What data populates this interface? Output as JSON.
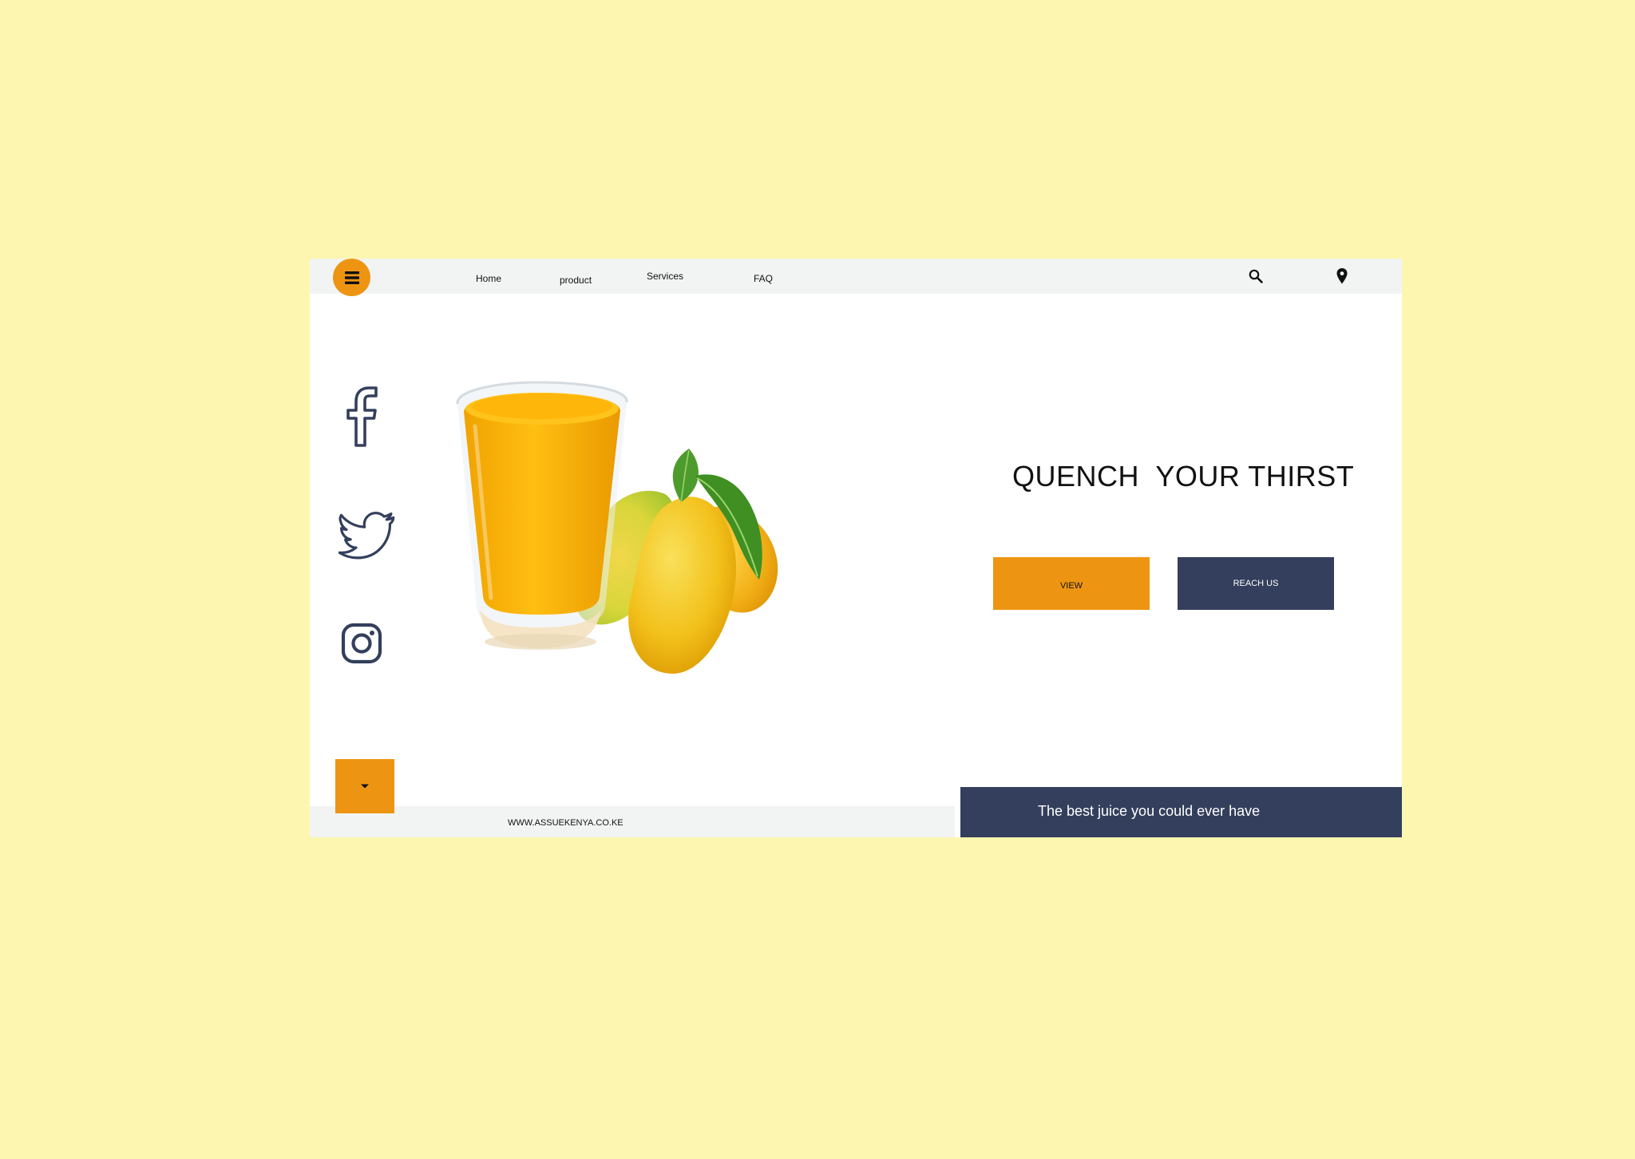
{
  "nav": {
    "items": [
      {
        "label": "Home"
      },
      {
        "label": "product"
      },
      {
        "label": "Services"
      },
      {
        "label": "FAQ"
      }
    ],
    "icons": [
      "menu-icon",
      "search-icon",
      "location-pin-icon"
    ]
  },
  "social": {
    "icons": [
      "facebook-icon",
      "twitter-icon",
      "instagram-icon"
    ]
  },
  "hero": {
    "headline": "QUENCH  YOUR THIRST",
    "view_label": "VIEW",
    "reach_label": "REACH US",
    "image": "mango-juice-glass-with-mangoes"
  },
  "footer": {
    "url": "WWW.ASSUEKENYA.CO.KE",
    "tagline": "The best juice you could ever have",
    "scroll_icon": "caret-down-icon"
  },
  "colors": {
    "background": "#fdf6b0",
    "accent_orange": "#ed9512",
    "navy": "#333f5c",
    "bar_grey": "#f2f4f4"
  }
}
